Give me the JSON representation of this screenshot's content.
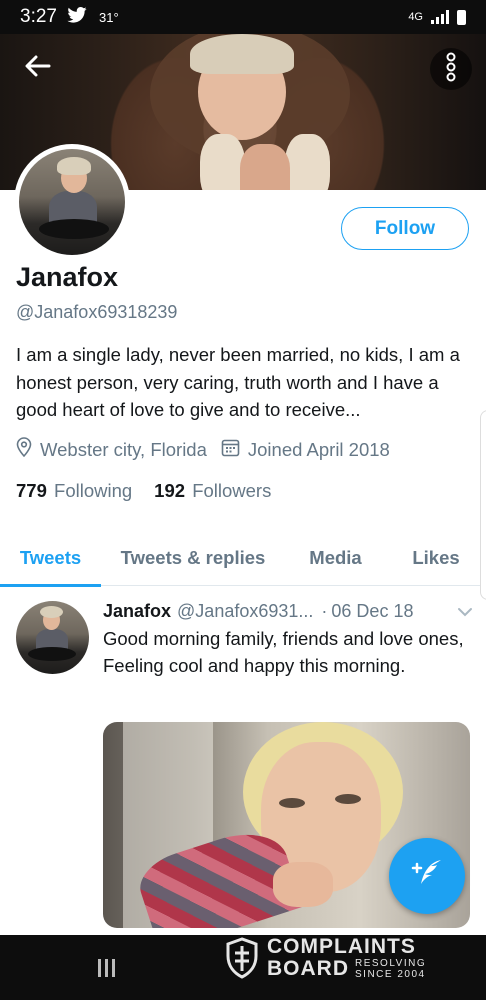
{
  "status_bar": {
    "time": "3:27",
    "temperature": "31°",
    "network": "4G"
  },
  "profile": {
    "display_name": "Janafox",
    "handle": "@Janafox69318239",
    "follow_label": "Follow",
    "bio": "I am a single lady, never been married, no kids, I am a honest person, very caring, truth worth and I have a good heart of love to give and to receive...",
    "location": "Webster city, Florida",
    "joined": "Joined April 2018",
    "following_count": "779",
    "following_label": "Following",
    "followers_count": "192",
    "followers_label": "Followers"
  },
  "tabs": [
    {
      "label": "Tweets",
      "active": true
    },
    {
      "label": "Tweets & replies",
      "active": false
    },
    {
      "label": "Media",
      "active": false
    },
    {
      "label": "Likes",
      "active": false
    }
  ],
  "tweet": {
    "name": "Janafox",
    "handle": "@Janafox6931...",
    "separator": "·",
    "date": "06 Dec 18",
    "text": "Good morning family, friends and love ones, Feeling cool and happy this morning."
  },
  "watermark": {
    "line1": "COMPLAINTS",
    "line2": "BOARD",
    "tag1": "RESOLVING",
    "tag2": "SINCE 2004"
  },
  "colors": {
    "accent": "#1da1f2",
    "text_primary": "#14171a",
    "text_secondary": "#657786"
  },
  "icons": [
    "back-arrow-icon",
    "more-vertical-icon",
    "location-pin-icon",
    "calendar-icon",
    "chevron-down-icon",
    "compose-tweet-icon",
    "recents-icon"
  ]
}
